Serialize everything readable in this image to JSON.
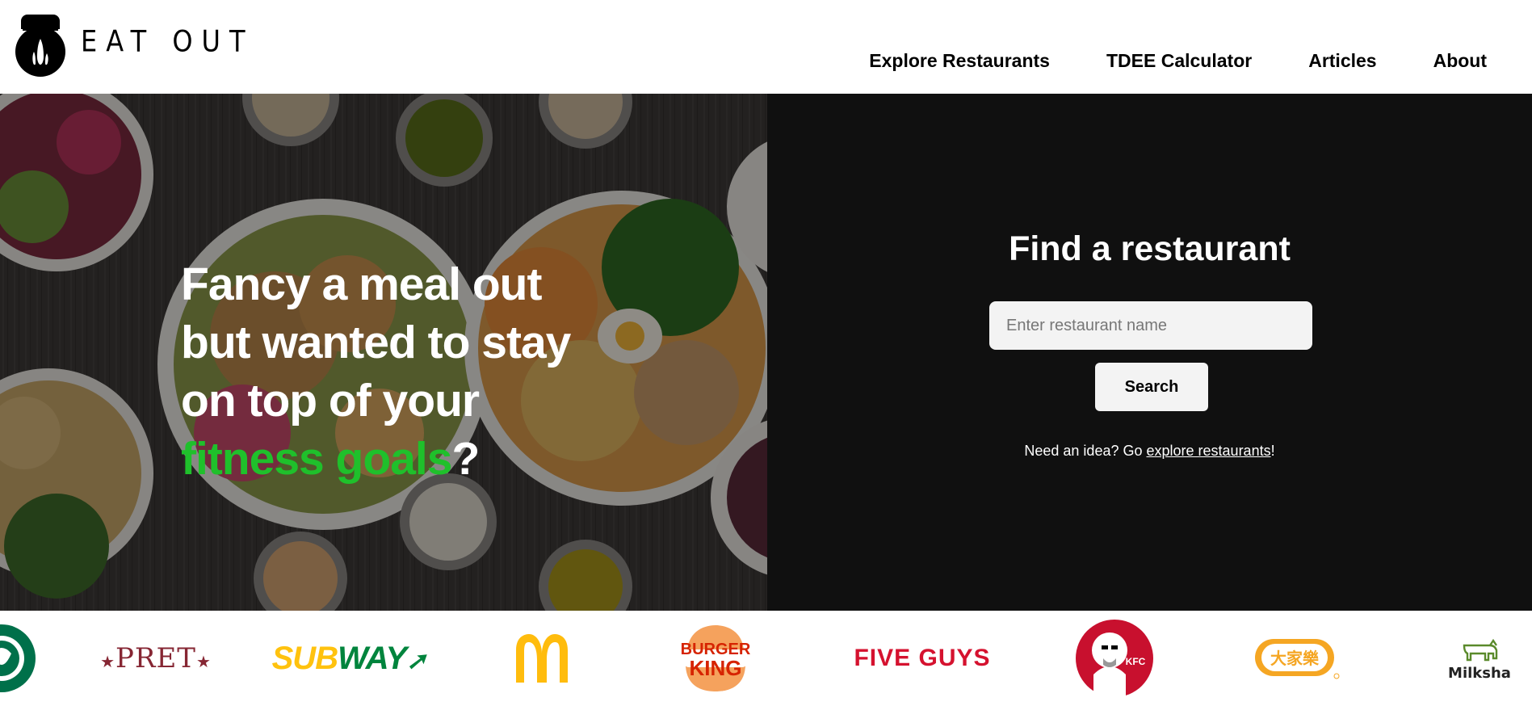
{
  "header": {
    "logo_text": "EAT OUT",
    "nav": [
      {
        "label": "Explore Restaurants"
      },
      {
        "label": "TDEE Calculator"
      },
      {
        "label": "Articles"
      },
      {
        "label": "About"
      }
    ]
  },
  "hero": {
    "headline_lines": [
      "Fancy a meal out",
      "but wanted to stay",
      "on top of your"
    ],
    "headline_highlight": "fitness goals",
    "headline_end": "?",
    "highlight_color": "#1fc02b"
  },
  "search": {
    "title": "Find a restaurant",
    "placeholder": "Enter restaurant name",
    "value": "",
    "button_label": "Search",
    "idea_prefix": "Need an idea? Go ",
    "idea_link": "explore restaurants",
    "idea_suffix": "!"
  },
  "brands": [
    {
      "name": "Starbucks",
      "icon": "starbucks-logo",
      "color": "#00704a"
    },
    {
      "name": "PRET",
      "icon": "pret-logo",
      "color": "#862633"
    },
    {
      "name": "SUBWAY",
      "icon": "subway-logo",
      "color": "#ffc20e"
    },
    {
      "name": "McDonald's",
      "icon": "mcdonalds-logo",
      "color": "#ffbc0d"
    },
    {
      "name": "BURGER KING",
      "icon": "burger-king-logo",
      "color": "#d62300"
    },
    {
      "name": "FIVE GUYS",
      "icon": "five-guys-logo",
      "color": "#d5122f"
    },
    {
      "name": "KFC",
      "icon": "kfc-logo",
      "color": "#c8102e"
    },
    {
      "name": "大家樂",
      "icon": "cafe-de-coral-logo",
      "color": "#f5a623"
    },
    {
      "name": "Milksha",
      "icon": "milksha-logo",
      "color": "#5a8a2b"
    }
  ]
}
